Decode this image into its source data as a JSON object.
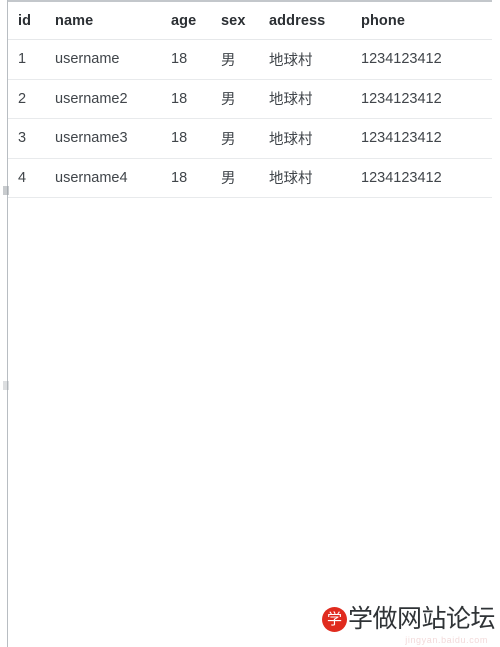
{
  "table": {
    "columns": [
      {
        "key": "id",
        "label": "id"
      },
      {
        "key": "name",
        "label": "name"
      },
      {
        "key": "age",
        "label": "age"
      },
      {
        "key": "sex",
        "label": "sex"
      },
      {
        "key": "address",
        "label": "address"
      },
      {
        "key": "phone",
        "label": "phone"
      }
    ],
    "rows": [
      {
        "id": "1",
        "name": "username",
        "age": "18",
        "sex": "男",
        "address": "地球村",
        "phone": "1234123412"
      },
      {
        "id": "2",
        "name": "username2",
        "age": "18",
        "sex": "男",
        "address": "地球村",
        "phone": "1234123412"
      },
      {
        "id": "3",
        "name": "username3",
        "age": "18",
        "sex": "男",
        "address": "地球村",
        "phone": "1234123412"
      },
      {
        "id": "4",
        "name": "username4",
        "age": "18",
        "sex": "男",
        "address": "地球村",
        "phone": "1234123412"
      }
    ]
  },
  "watermark": {
    "badge_text": "学",
    "text": "学做网站论坛",
    "url": "jingyan.baidu.com",
    "badge_color": "#e02b1e",
    "text_color": "#2f3336"
  },
  "colors": {
    "header_text": "#2b2f33",
    "cell_text": "#40454a",
    "top_border": "#c3c7cb",
    "row_border": "#e8eaec",
    "page_rule": "#b8bdc2",
    "background": "#ffffff"
  }
}
